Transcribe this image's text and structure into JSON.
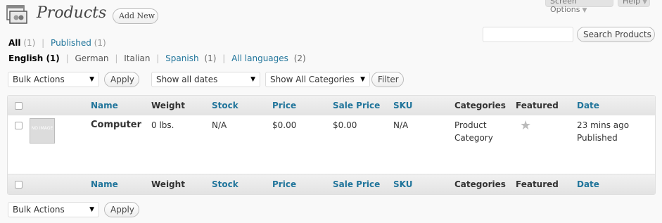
{
  "screen_meta": {
    "screen_options": "Screen Options",
    "help": "Help"
  },
  "header": {
    "title": "Products",
    "add_new": "Add New"
  },
  "search": {
    "placeholder": "",
    "button": "Search Products"
  },
  "status_links": [
    {
      "label": "All",
      "count": "(1)",
      "current": true
    },
    {
      "label": "Published",
      "count": "(1)",
      "current": false
    }
  ],
  "language_links": [
    {
      "label": "English",
      "count": "(1)",
      "current": true
    },
    {
      "label": "German",
      "count": ""
    },
    {
      "label": "Italian",
      "count": ""
    },
    {
      "label": "Spanish",
      "count": "(1)"
    },
    {
      "label": "All languages",
      "count": "(2)"
    }
  ],
  "filters": {
    "bulk_actions": "Bulk Actions",
    "apply": "Apply",
    "dates": "Show all dates",
    "categories": "Show All Categories",
    "filter": "Filter"
  },
  "columns": {
    "name": "Name",
    "weight": "Weight",
    "stock": "Stock",
    "price": "Price",
    "sale_price": "Sale Price",
    "sku": "SKU",
    "categories": "Categories",
    "featured": "Featured",
    "date": "Date"
  },
  "rows": [
    {
      "thumb_text": "NO IMAGE",
      "name": "Computer",
      "weight": "0 lbs.",
      "stock": "N/A",
      "price": "$0.00",
      "sale_price": "$0.00",
      "sku": "N/A",
      "category_line1": "Product",
      "category_line2": "Category",
      "featured_icon": "star-icon",
      "date": "23 mins ago",
      "status": "Published"
    }
  ],
  "bottom": {
    "bulk_actions": "Bulk Actions",
    "apply": "Apply"
  }
}
